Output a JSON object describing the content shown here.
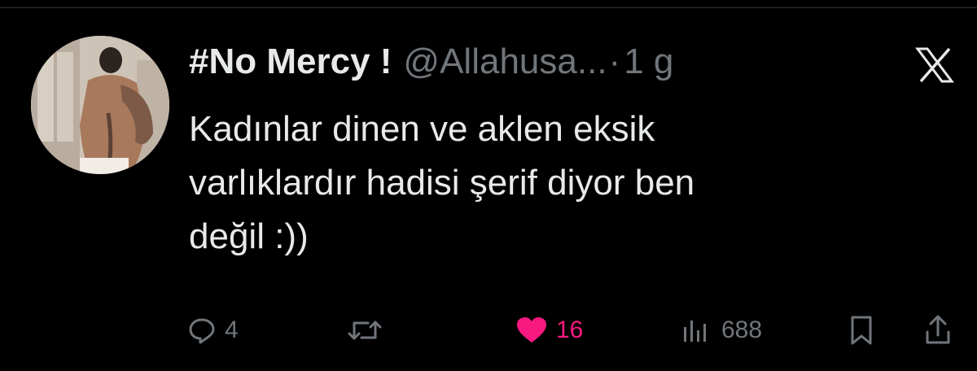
{
  "tweet": {
    "display_name": "#No Mercy !",
    "handle": "@Allahusa...",
    "separator": "·",
    "time": "1 g",
    "text": "Kadınlar dinen ve aklen eksik\nvarlıklardır hadisi şerif diyor ben\ndeğil :))"
  },
  "actions": {
    "reply_count": "4",
    "retweet_count": "",
    "like_count": "16",
    "views_count": "688"
  },
  "icons": {
    "reply": "reply-icon",
    "retweet": "retweet-icon",
    "like": "heart-icon",
    "views": "views-icon",
    "bookmark": "bookmark-icon",
    "share": "share-icon",
    "logo": "x-logo-icon"
  },
  "colors": {
    "background": "#000000",
    "text_primary": "#e7e9ea",
    "text_secondary": "#71767b",
    "like_accent": "#f91880"
  }
}
